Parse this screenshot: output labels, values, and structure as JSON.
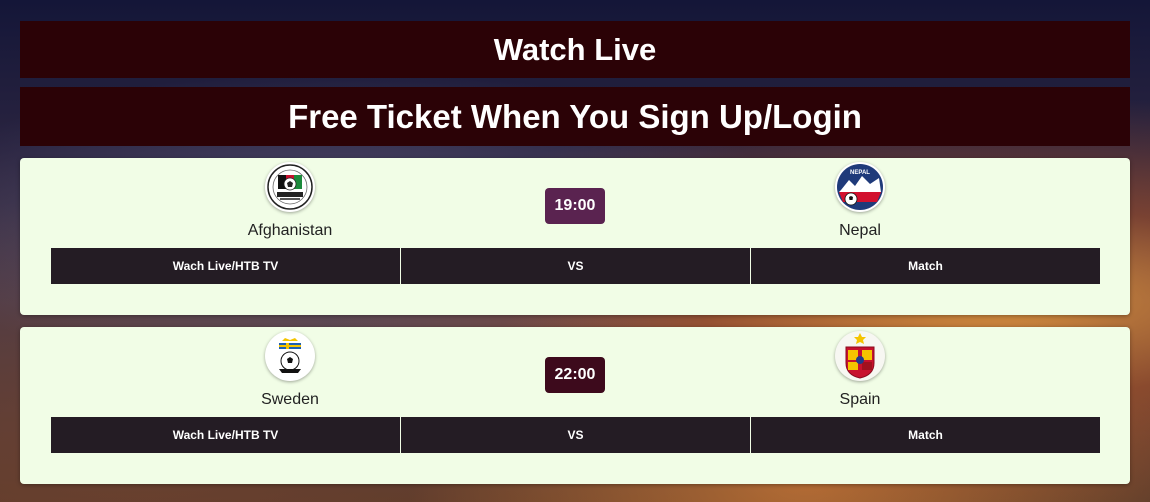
{
  "header": {
    "title": "Watch Live",
    "subtitle": "Free Ticket When You Sign Up/Login"
  },
  "matches": [
    {
      "home": {
        "name": "Afghanistan",
        "logo_icon": "afghanistan-crest-icon"
      },
      "away": {
        "name": "Nepal",
        "logo_icon": "nepal-crest-icon"
      },
      "time": "19:00",
      "time_color": "#5a2350",
      "actions": {
        "live": "Wach Live/HTB TV",
        "vs": "VS",
        "match": "Match"
      }
    },
    {
      "home": {
        "name": "Sweden",
        "logo_icon": "sweden-crest-icon"
      },
      "away": {
        "name": "Spain",
        "logo_icon": "spain-crest-icon"
      },
      "time": "22:00",
      "time_color": "#3d0a1c",
      "actions": {
        "live": "Wach Live/HTB TV",
        "vs": "VS",
        "match": "Match"
      }
    }
  ],
  "colors": {
    "banner_bg": "#2b0206",
    "card_bg": "#f1fde6",
    "action_bg": "#241c24"
  }
}
